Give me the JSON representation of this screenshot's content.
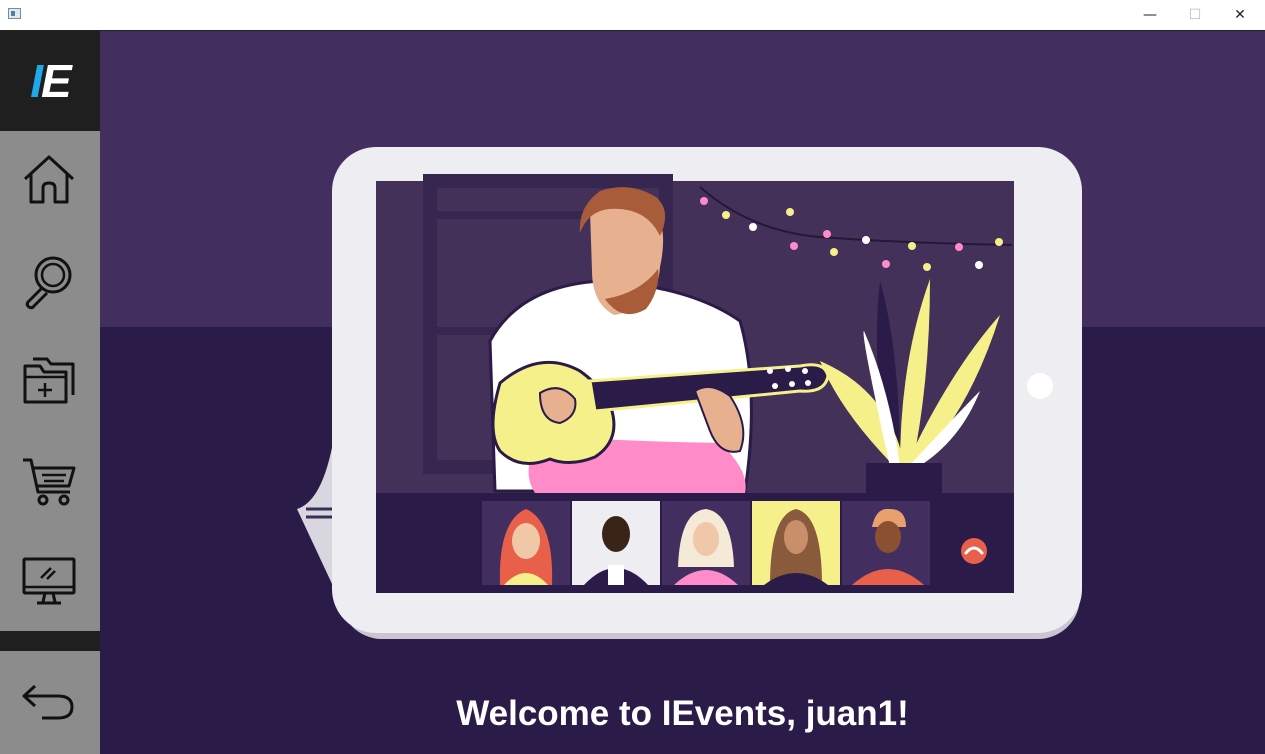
{
  "window": {
    "minimize_glyph": "—",
    "maximize_glyph": "☐",
    "close_glyph": "✕"
  },
  "sidebar": {
    "logo": {
      "letter_i": "I",
      "letter_e": "E"
    },
    "nav_items": [
      {
        "name": "home",
        "icon": "home-icon"
      },
      {
        "name": "search",
        "icon": "search-icon"
      },
      {
        "name": "add-folder",
        "icon": "add-folder-icon"
      },
      {
        "name": "cart",
        "icon": "cart-icon"
      },
      {
        "name": "monitor",
        "icon": "monitor-icon"
      }
    ],
    "back_icon": "back-arrow-icon"
  },
  "main": {
    "welcome_text": "Welcome to IEvents, juan1!"
  },
  "colors": {
    "sidebar_bg": "#8c8c8c",
    "logo_bg": "#1f1f1f",
    "logo_accent": "#21a8e8",
    "main_bg": "#2b1b48",
    "wall_bg": "#432f5f",
    "guitar": "#f5f08a",
    "pants": "#ff8cc8",
    "call_end": "#e8604a"
  }
}
